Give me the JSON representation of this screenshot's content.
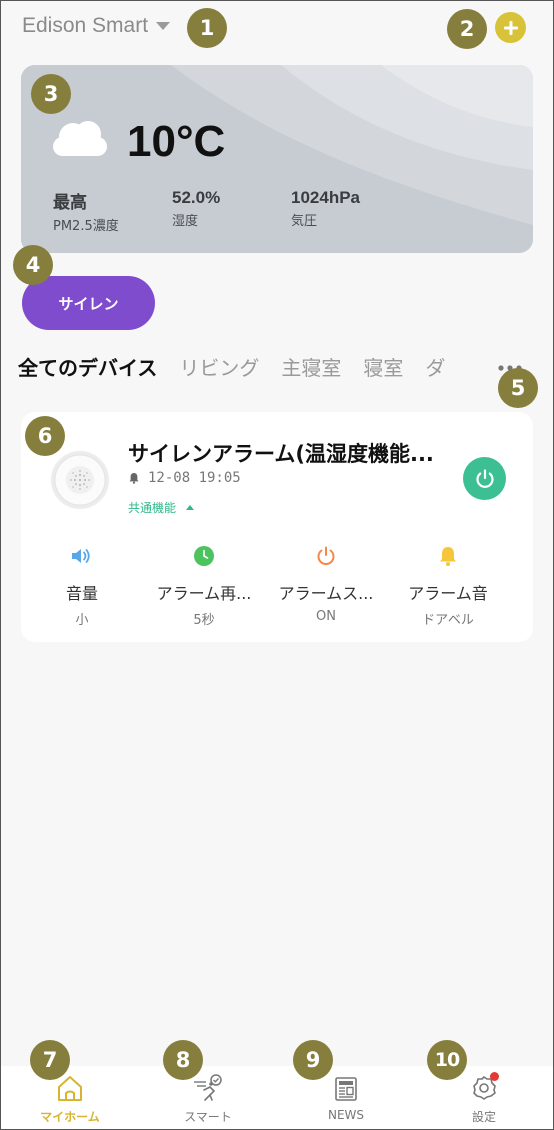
{
  "header": {
    "home_name": "Edison Smart"
  },
  "weather": {
    "temperature": "10°C",
    "stats": [
      {
        "value": "最高",
        "label": "PM2.5濃度"
      },
      {
        "value": "52.0%",
        "label": "湿度"
      },
      {
        "value": "1024hPa",
        "label": "気圧"
      }
    ]
  },
  "scene": {
    "label": "サイレン"
  },
  "tabs": [
    {
      "label": "全てのデバイス"
    },
    {
      "label": "リビング"
    },
    {
      "label": "主寝室"
    },
    {
      "label": "寝室"
    },
    {
      "label": "ダ"
    }
  ],
  "device": {
    "name": "サイレンアラーム(温湿度機能...",
    "alarm_time": "12-08 19:05",
    "common_label": "共通機能",
    "functions": [
      {
        "title": "音量",
        "value": "小",
        "icon": "speaker-icon",
        "color": "#5aa7e8"
      },
      {
        "title": "アラーム再...",
        "value": "5秒",
        "icon": "clock-icon",
        "color": "#4cc35e"
      },
      {
        "title": "アラームス...",
        "value": "ON",
        "icon": "power-icon",
        "color": "#f08a4b"
      },
      {
        "title": "アラーム音",
        "value": "ドアベル",
        "icon": "bell-icon",
        "color": "#f5c53a"
      }
    ]
  },
  "nav": {
    "items": [
      {
        "label": "マイホーム",
        "icon": "home-icon"
      },
      {
        "label": "スマート",
        "icon": "smart-scene-icon"
      },
      {
        "label": "NEWS",
        "icon": "news-icon"
      },
      {
        "label": "設定",
        "icon": "settings-icon"
      }
    ]
  },
  "markers": [
    "1",
    "2",
    "3",
    "4",
    "5",
    "6",
    "7",
    "8",
    "9",
    "10"
  ],
  "colors": {
    "accent": "#d7b431",
    "scene_purple": "#7f4ccd",
    "power_green": "#3bbf93",
    "marker": "#857e3c"
  }
}
